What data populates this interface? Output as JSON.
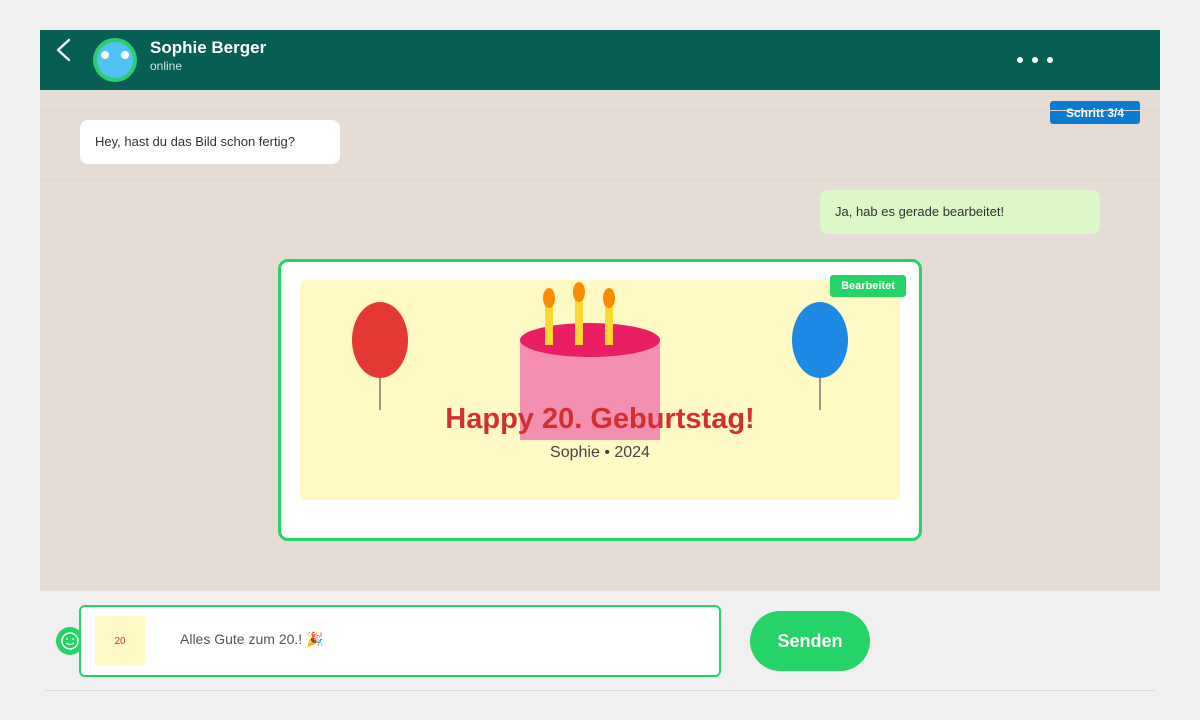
{
  "header": {
    "contact_name": "Sophie Berger",
    "contact_status": "online",
    "back_icon": "chevron-left-icon",
    "more_icon": "more-horizontal-icon",
    "color": "#075e54"
  },
  "step_badge": "Schritt 3/4",
  "messages": [
    {
      "direction": "incoming",
      "text": "Hey, hast du das Bild schon fertig?"
    },
    {
      "direction": "outgoing",
      "text": "Ja, hab es gerade bearbeitet!"
    }
  ],
  "image_message": {
    "edited_label": "Bearbeitet",
    "title": "Happy 20. Geburtstag!",
    "subtitle": "Sophie • 2024",
    "balloon_left_color": "#e53935",
    "balloon_right_color": "#1e88e5",
    "cake_color": "#f48fb1",
    "frosting_color": "#e91e63",
    "candle_count": 3
  },
  "composer": {
    "emoji_icon": "emoji-icon",
    "thumbnail_text": "20",
    "input_value": "Alles Gute zum 20.! 🎉",
    "send_label": "Senden"
  },
  "colors": {
    "accent": "#25d366",
    "chat_background": "#e5ddd5",
    "outgoing_bubble": "#dcf8c6",
    "step_badge": "#0b7ad1"
  }
}
